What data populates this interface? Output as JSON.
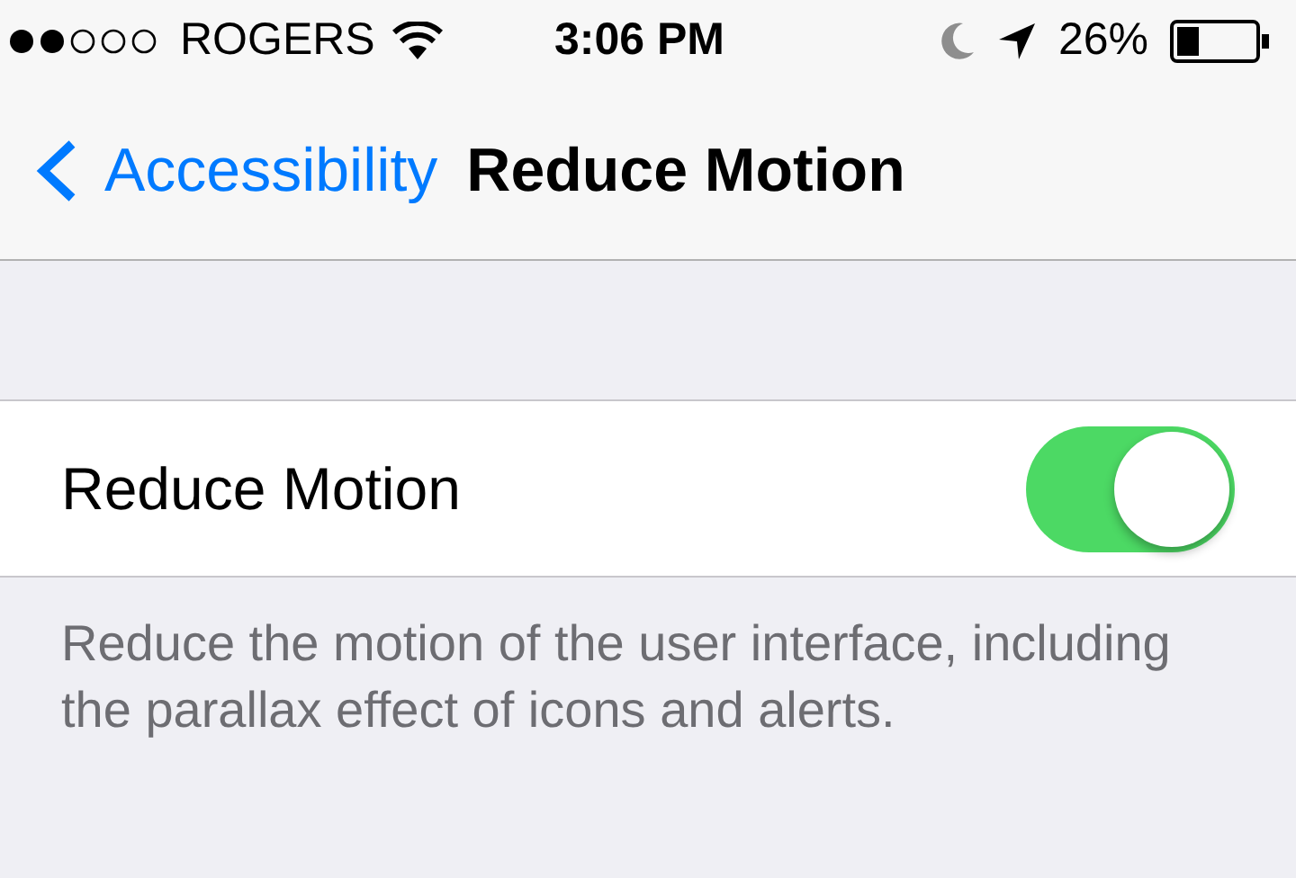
{
  "status_bar": {
    "carrier": "ROGERS",
    "time": "3:06 PM",
    "battery": "26%"
  },
  "nav_bar": {
    "back": "Accessibility",
    "title": "Reduce Motion"
  },
  "setting": {
    "label": "Reduce Motion",
    "on": true
  },
  "footer": "Reduce the motion of the user interface, including the parallax effect of icons and alerts."
}
